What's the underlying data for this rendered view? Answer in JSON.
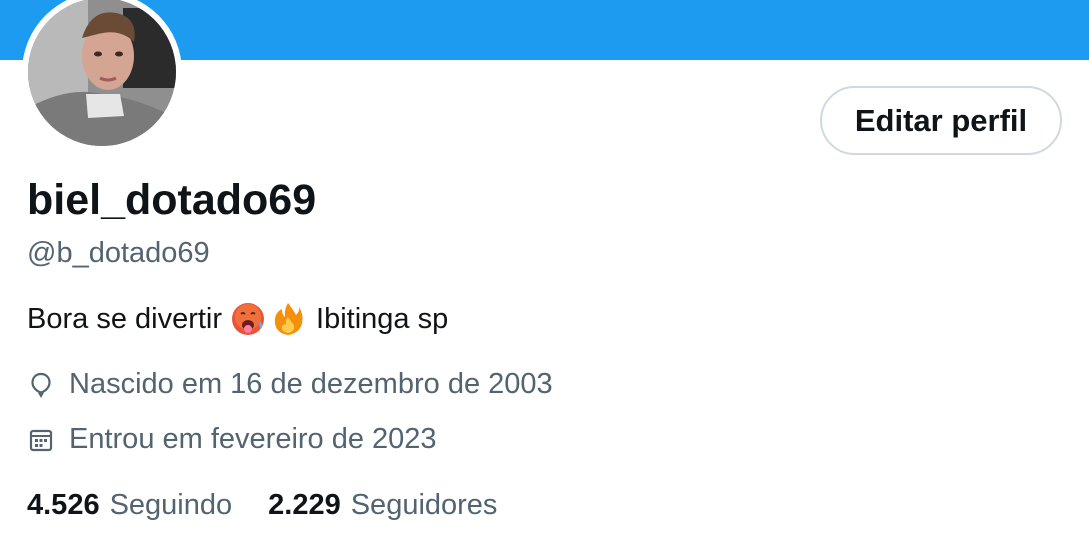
{
  "colors": {
    "banner": "#1d9bf0",
    "text_primary": "#0f1419",
    "text_secondary": "#536471",
    "button_border": "#cfd9de"
  },
  "profile": {
    "display_name": "biel_dotado69",
    "handle": "@b_dotado69",
    "edit_button_label": "Editar perfil",
    "bio": {
      "text_before": "Bora se divertir",
      "emojis": [
        "hot-face-emoji",
        "fire-emoji"
      ],
      "text_after": "Ibitinga sp"
    },
    "birth": {
      "icon": "balloon-icon",
      "text": "Nascido em 16 de dezembro de 2003"
    },
    "joined": {
      "icon": "calendar-icon",
      "text": "Entrou em fevereiro de 2023"
    },
    "stats": {
      "following_count": "4.526",
      "following_label": "Seguindo",
      "followers_count": "2.229",
      "followers_label": "Seguidores"
    }
  }
}
